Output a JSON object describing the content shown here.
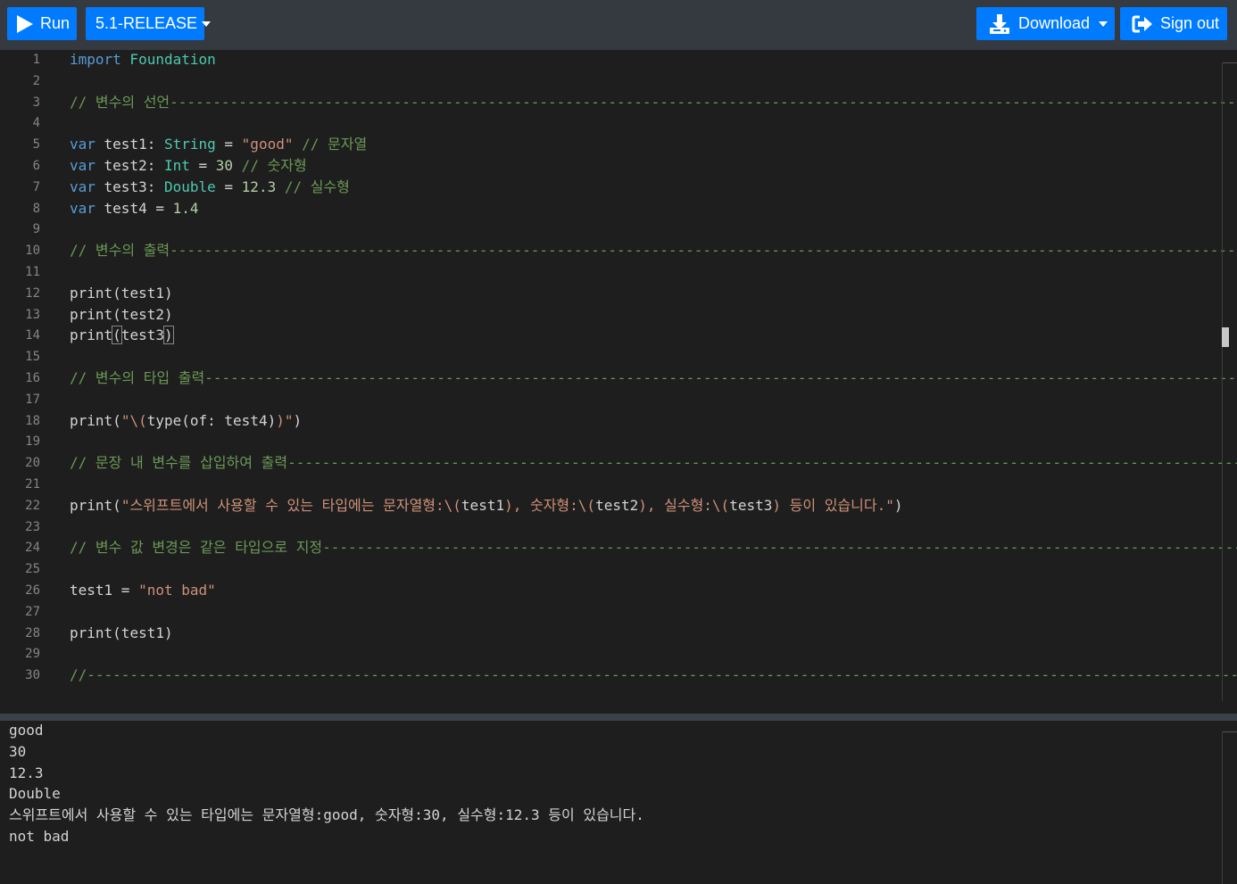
{
  "toolbar": {
    "run_label": "Run",
    "version_label": "5.1-RELEASE",
    "download_label": "Download",
    "signout_label": "Sign out",
    "accent_color": "#007bff",
    "icons": [
      "play-icon",
      "caret-down-icon",
      "download-icon",
      "sign-out-icon"
    ]
  },
  "editor": {
    "language": "swift",
    "lines": [
      {
        "n": "1",
        "tokens": [
          [
            "kw",
            "import"
          ],
          [
            "",
            ""
          ],
          [
            "ty",
            " Foundation"
          ]
        ]
      },
      {
        "n": "2",
        "tokens": []
      },
      {
        "n": "3",
        "tokens": [
          [
            "cm",
            "// 변수의 선언----------------------------------------------------------------------------------------------------------------------------------------------------------------------"
          ]
        ]
      },
      {
        "n": "4",
        "tokens": []
      },
      {
        "n": "5",
        "tokens": [
          [
            "kw",
            "var"
          ],
          [
            "",
            " test1: "
          ],
          [
            "ty",
            "String"
          ],
          [
            "",
            " = "
          ],
          [
            "str",
            "\"good\""
          ],
          [
            "cm",
            " // 문자열"
          ]
        ]
      },
      {
        "n": "6",
        "tokens": [
          [
            "kw",
            "var"
          ],
          [
            "",
            " test2: "
          ],
          [
            "ty",
            "Int"
          ],
          [
            "",
            " = "
          ],
          [
            "num",
            "30"
          ],
          [
            "cm",
            " // 숫자형"
          ]
        ]
      },
      {
        "n": "7",
        "tokens": [
          [
            "kw",
            "var"
          ],
          [
            "",
            " test3: "
          ],
          [
            "ty",
            "Double"
          ],
          [
            "",
            " = "
          ],
          [
            "num",
            "12.3"
          ],
          [
            "cm",
            " // 실수형"
          ]
        ]
      },
      {
        "n": "8",
        "tokens": [
          [
            "kw",
            "var"
          ],
          [
            "",
            " test4 = "
          ],
          [
            "num",
            "1.4"
          ]
        ]
      },
      {
        "n": "9",
        "tokens": []
      },
      {
        "n": "10",
        "tokens": [
          [
            "cm",
            "// 변수의 출력----------------------------------------------------------------------------------------------------------------------------------------------------------------------"
          ]
        ]
      },
      {
        "n": "11",
        "tokens": []
      },
      {
        "n": "12",
        "tokens": [
          [
            "fn",
            "print"
          ],
          [
            "",
            "(test1)"
          ]
        ]
      },
      {
        "n": "13",
        "tokens": [
          [
            "fn",
            "print"
          ],
          [
            "",
            "(test2)"
          ]
        ]
      },
      {
        "n": "14",
        "tokens": [
          [
            "fn",
            "print"
          ],
          [
            "box",
            "("
          ],
          [
            "",
            "test3"
          ],
          [
            "box",
            ")"
          ]
        ]
      },
      {
        "n": "15",
        "tokens": []
      },
      {
        "n": "16",
        "tokens": [
          [
            "cm",
            "// 변수의 타입 출력------------------------------------------------------------------------------------------------------------------------------------------------------------------"
          ]
        ]
      },
      {
        "n": "17",
        "tokens": []
      },
      {
        "n": "18",
        "tokens": [
          [
            "fn",
            "print"
          ],
          [
            "",
            "("
          ],
          [
            "str",
            "\"\\("
          ],
          [
            "fn",
            "type"
          ],
          [
            "",
            "(of: test4)"
          ],
          [
            "str",
            ")\""
          ],
          [
            "",
            ")"
          ]
        ]
      },
      {
        "n": "19",
        "tokens": []
      },
      {
        "n": "20",
        "tokens": [
          [
            "cm",
            "// 문장 내 변수를 삽입하여 출력---------------------------------------------------------------------------------------------------------------------------------------------------"
          ]
        ]
      },
      {
        "n": "21",
        "tokens": []
      },
      {
        "n": "22",
        "tokens": [
          [
            "fn",
            "print"
          ],
          [
            "",
            "("
          ],
          [
            "str",
            "\"스위프트에서 사용할 수 있는 타입에는 문자열형:\\("
          ],
          [
            "",
            "test1"
          ],
          [
            "str",
            "), 숫자형:\\("
          ],
          [
            "",
            "test2"
          ],
          [
            "str",
            "), 실수형:\\("
          ],
          [
            "",
            "test3"
          ],
          [
            "str",
            ") 등이 있습니다.\""
          ],
          [
            "",
            ")"
          ]
        ]
      },
      {
        "n": "23",
        "tokens": []
      },
      {
        "n": "24",
        "tokens": [
          [
            "cm",
            "// 변수 값 변경은 같은 타입으로 지정-------------------------------------------------------------------------------------------------------------------------------------------------"
          ]
        ]
      },
      {
        "n": "25",
        "tokens": []
      },
      {
        "n": "26",
        "tokens": [
          [
            "",
            "test1 = "
          ],
          [
            "str",
            "\"not bad\""
          ]
        ]
      },
      {
        "n": "27",
        "tokens": []
      },
      {
        "n": "28",
        "tokens": [
          [
            "fn",
            "print"
          ],
          [
            "",
            "(test1)"
          ]
        ]
      },
      {
        "n": "29",
        "tokens": []
      },
      {
        "n": "30",
        "tokens": [
          [
            "cm",
            "//-------------------------------------------------------------------------------------------------------------------------------------------------------------------------------"
          ]
        ]
      }
    ]
  },
  "output": {
    "lines": [
      "good",
      "30",
      "12.3",
      "Double",
      "스위프트에서 사용할 수 있는 타입에는 문자열형:good, 숫자형:30, 실수형:12.3 등이 있습니다.",
      "not bad"
    ]
  }
}
